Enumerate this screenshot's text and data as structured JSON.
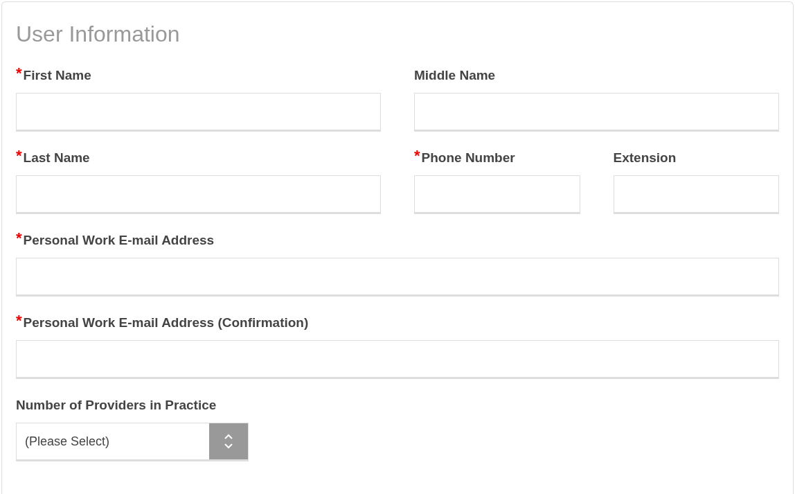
{
  "title": "User Information",
  "required_marker": "*",
  "rows": [
    {
      "fields": [
        {
          "label": "First Name",
          "required": true,
          "kind": "input"
        },
        {
          "label": "Middle Name",
          "required": false,
          "kind": "input"
        }
      ]
    },
    {
      "fields": [
        {
          "label": "Last Name",
          "required": true,
          "kind": "input"
        },
        {
          "label": "Phone Number",
          "required": true,
          "kind": "input"
        },
        {
          "label": "Extension",
          "required": false,
          "kind": "input"
        }
      ]
    },
    {
      "fields": [
        {
          "label": "Personal Work E-mail Address",
          "required": true,
          "kind": "input"
        }
      ]
    },
    {
      "fields": [
        {
          "label": "Personal Work E-mail Address (Confirmation)",
          "required": true,
          "kind": "input"
        }
      ]
    },
    {
      "fields": [
        {
          "label": "Number of Providers in Practice",
          "required": false,
          "kind": "select",
          "value": "(Please Select)"
        }
      ]
    }
  ]
}
